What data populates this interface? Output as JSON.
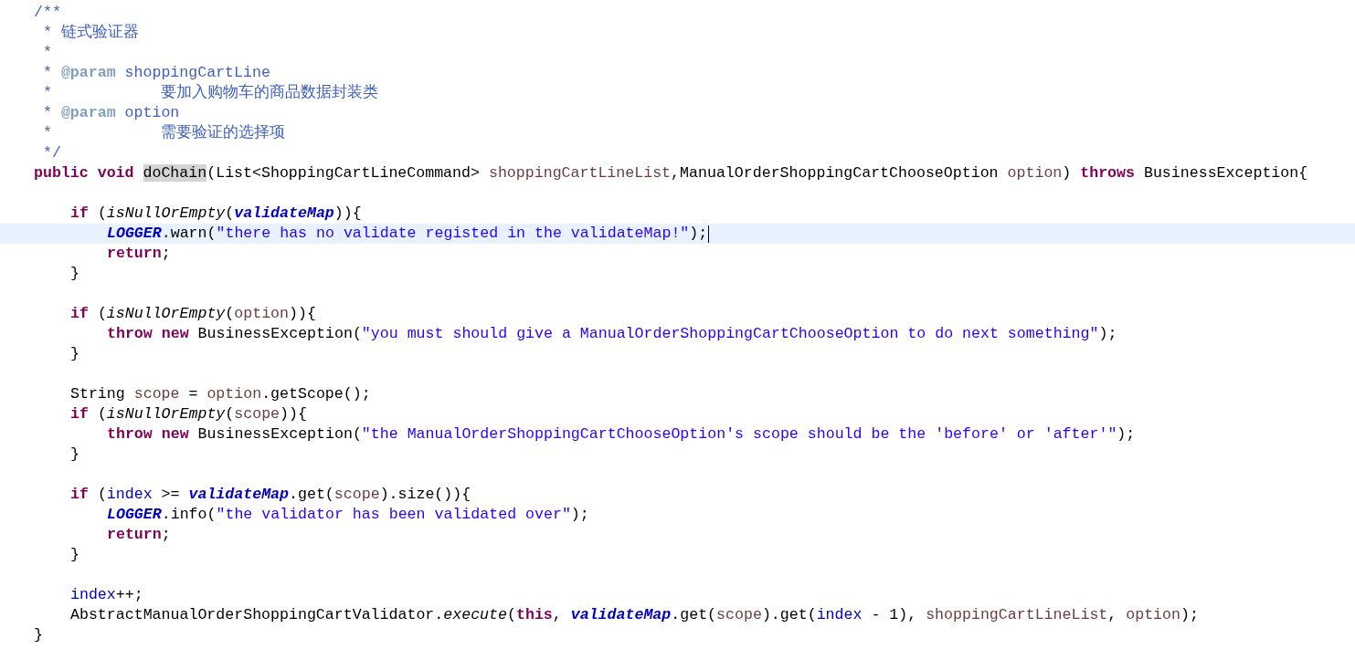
{
  "editor": {
    "lines": [
      {
        "current": false,
        "tokens": [
          {
            "text": "/**",
            "kind": "comment"
          }
        ]
      },
      {
        "current": false,
        "tokens": [
          {
            "text": " * 链式验证器",
            "kind": "comment"
          }
        ]
      },
      {
        "current": false,
        "tokens": [
          {
            "text": " *",
            "kind": "comment"
          }
        ]
      },
      {
        "current": false,
        "tokens": [
          {
            "text": " * ",
            "kind": "comment"
          },
          {
            "text": "@param",
            "kind": "tag"
          },
          {
            "text": " shoppingCartLine",
            "kind": "comment"
          }
        ]
      },
      {
        "current": false,
        "tokens": [
          {
            "text": " *            要加入购物车的商品数据封装类",
            "kind": "comment"
          }
        ]
      },
      {
        "current": false,
        "tokens": [
          {
            "text": " * ",
            "kind": "comment"
          },
          {
            "text": "@param",
            "kind": "tag"
          },
          {
            "text": " option",
            "kind": "comment"
          }
        ]
      },
      {
        "current": false,
        "tokens": [
          {
            "text": " *            需要验证的选择项",
            "kind": "comment"
          }
        ]
      },
      {
        "current": false,
        "tokens": [
          {
            "text": " */",
            "kind": "comment"
          }
        ]
      },
      {
        "current": false,
        "tokens": [
          {
            "text": "public void ",
            "kind": "keyword"
          },
          {
            "text": "doChain",
            "kind": "occurrence"
          },
          {
            "text": "(List<ShoppingCartLineCommand> ",
            "kind": "plain"
          },
          {
            "text": "shoppingCartLineList",
            "kind": "param"
          },
          {
            "text": ",ManualOrderShoppingCartChooseOption ",
            "kind": "plain"
          },
          {
            "text": "option",
            "kind": "param"
          },
          {
            "text": ") ",
            "kind": "plain"
          },
          {
            "text": "throws",
            "kind": "keyword"
          },
          {
            "text": " BusinessException{",
            "kind": "plain"
          }
        ],
        "children": [
          {
            "current": false
          },
          {
            "current": false,
            "tokens": [
              {
                "text": "if ",
                "kind": "keyword"
              },
              {
                "text": "(",
                "kind": "plain"
              },
              {
                "text": "isNullOrEmpty",
                "kind": "static_method"
              },
              {
                "text": "(",
                "kind": "plain"
              },
              {
                "text": "validateMap",
                "kind": "static_field"
              },
              {
                "text": ")){",
                "kind": "plain"
              }
            ],
            "children": [
              {
                "current": true,
                "tokens": [
                  {
                    "text": "LOGGER",
                    "kind": "static_field"
                  },
                  {
                    "text": ".warn(",
                    "kind": "plain"
                  },
                  {
                    "text": "\"there has no validate registed in the validateMap!\"",
                    "kind": "string"
                  },
                  {
                    "text": ");",
                    "kind": "plain"
                  }
                ]
              },
              {
                "current": false,
                "tokens": [
                  {
                    "text": "return",
                    "kind": "keyword"
                  },
                  {
                    "text": ";",
                    "kind": "plain"
                  }
                ]
              }
            ]
          },
          {
            "current": false,
            "tokens": [
              {
                "text": "}",
                "kind": "plain"
              }
            ]
          },
          {
            "current": false
          },
          {
            "current": false,
            "tokens": [
              {
                "text": "if ",
                "kind": "keyword"
              },
              {
                "text": "(",
                "kind": "plain"
              },
              {
                "text": "isNullOrEmpty",
                "kind": "static_method"
              },
              {
                "text": "(",
                "kind": "plain"
              },
              {
                "text": "option",
                "kind": "param"
              },
              {
                "text": ")){",
                "kind": "plain"
              }
            ],
            "children": [
              {
                "current": false,
                "tokens": [
                  {
                    "text": "throw new ",
                    "kind": "keyword"
                  },
                  {
                    "text": "BusinessException(",
                    "kind": "plain"
                  },
                  {
                    "text": "\"you must should give a ManualOrderShoppingCartChooseOption to do next something\"",
                    "kind": "string"
                  },
                  {
                    "text": ");",
                    "kind": "plain"
                  }
                ]
              }
            ]
          },
          {
            "current": false,
            "tokens": [
              {
                "text": "}",
                "kind": "plain"
              }
            ]
          },
          {
            "current": false
          },
          {
            "current": false,
            "tokens": [
              {
                "text": "String ",
                "kind": "plain"
              },
              {
                "text": "scope",
                "kind": "param"
              },
              {
                "text": " = ",
                "kind": "plain"
              },
              {
                "text": "option",
                "kind": "param"
              },
              {
                "text": ".getScope();",
                "kind": "plain"
              }
            ]
          },
          {
            "current": false,
            "tokens": [
              {
                "text": "if ",
                "kind": "keyword"
              },
              {
                "text": "(",
                "kind": "plain"
              },
              {
                "text": "isNullOrEmpty",
                "kind": "static_method"
              },
              {
                "text": "(",
                "kind": "plain"
              },
              {
                "text": "scope",
                "kind": "param"
              },
              {
                "text": ")){",
                "kind": "plain"
              }
            ],
            "children": [
              {
                "current": false,
                "tokens": [
                  {
                    "text": "throw new ",
                    "kind": "keyword"
                  },
                  {
                    "text": "BusinessException(",
                    "kind": "plain"
                  },
                  {
                    "text": "\"the ManualOrderShoppingCartChooseOption's scope should be the 'before' or 'after'\"",
                    "kind": "string"
                  },
                  {
                    "text": ");",
                    "kind": "plain"
                  }
                ]
              }
            ]
          },
          {
            "current": false,
            "tokens": [
              {
                "text": "}",
                "kind": "plain"
              }
            ]
          },
          {
            "current": false
          },
          {
            "current": false,
            "tokens": [
              {
                "text": "if ",
                "kind": "keyword"
              },
              {
                "text": "(",
                "kind": "plain"
              },
              {
                "text": "index",
                "kind": "field"
              },
              {
                "text": " >= ",
                "kind": "plain"
              },
              {
                "text": "validateMap",
                "kind": "static_field"
              },
              {
                "text": ".get(",
                "kind": "plain"
              },
              {
                "text": "scope",
                "kind": "param"
              },
              {
                "text": ").size()){",
                "kind": "plain"
              }
            ],
            "children": [
              {
                "current": false,
                "tokens": [
                  {
                    "text": "LOGGER",
                    "kind": "static_field"
                  },
                  {
                    "text": ".info(",
                    "kind": "plain"
                  },
                  {
                    "text": "\"the validator has been validated over\"",
                    "kind": "string"
                  },
                  {
                    "text": ");",
                    "kind": "plain"
                  }
                ]
              },
              {
                "current": false,
                "tokens": [
                  {
                    "text": "return",
                    "kind": "keyword"
                  },
                  {
                    "text": ";",
                    "kind": "plain"
                  }
                ]
              }
            ]
          },
          {
            "current": false,
            "tokens": [
              {
                "text": "}",
                "kind": "plain"
              }
            ]
          },
          {
            "current": false
          },
          {
            "current": false,
            "tokens": [
              {
                "text": "index",
                "kind": "field"
              },
              {
                "text": "++;",
                "kind": "plain"
              }
            ]
          },
          {
            "current": false,
            "tokens": [
              {
                "text": "AbstractManualOrderShoppingCartValidator.",
                "kind": "plain"
              },
              {
                "text": "execute",
                "kind": "static_method"
              },
              {
                "text": "(",
                "kind": "plain"
              },
              {
                "text": "this",
                "kind": "keyword"
              },
              {
                "text": ", ",
                "kind": "plain"
              },
              {
                "text": "validateMap",
                "kind": "static_field"
              },
              {
                "text": ".get(",
                "kind": "plain"
              },
              {
                "text": "scope",
                "kind": "param"
              },
              {
                "text": ").get(",
                "kind": "plain"
              },
              {
                "text": "index",
                "kind": "field"
              },
              {
                "text": " - 1), ",
                "kind": "plain"
              },
              {
                "text": "shoppingCartLineList",
                "kind": "param"
              },
              {
                "text": ", ",
                "kind": "plain"
              },
              {
                "text": "option",
                "kind": "param"
              },
              {
                "text": ");",
                "kind": "plain"
              }
            ]
          }
        ]
      },
      {
        "current": false,
        "tokens": [
          {
            "text": "}",
            "kind": "plain"
          }
        ]
      }
    ]
  }
}
